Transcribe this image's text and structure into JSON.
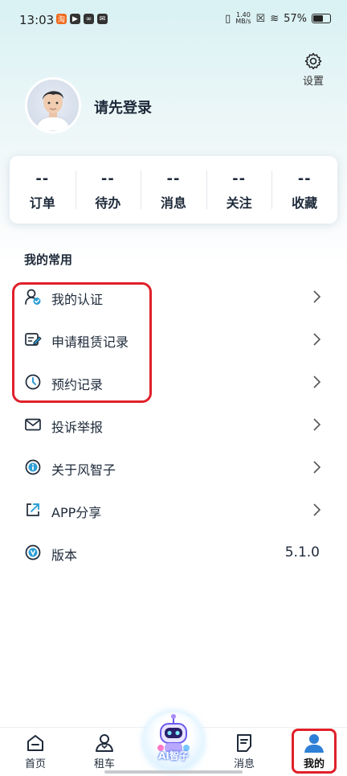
{
  "status": {
    "time": "13:03",
    "netspeed_top": "1.40",
    "netspeed_unit": "MB/s",
    "battery": "57%"
  },
  "header": {
    "settings_label": "设置",
    "login_prompt": "请先登录"
  },
  "stats": [
    {
      "value": "--",
      "label": "订单"
    },
    {
      "value": "--",
      "label": "待办"
    },
    {
      "value": "--",
      "label": "消息"
    },
    {
      "value": "--",
      "label": "关注"
    },
    {
      "value": "--",
      "label": "收藏"
    }
  ],
  "section": {
    "title": "我的常用"
  },
  "menu": [
    {
      "label": "我的认证",
      "icon": "user-verified-icon"
    },
    {
      "label": "申请租赁记录",
      "icon": "edit-document-icon"
    },
    {
      "label": "预约记录",
      "icon": "clock-icon"
    },
    {
      "label": "投诉举报",
      "icon": "mail-icon"
    },
    {
      "label": "关于风智子",
      "icon": "info-icon"
    },
    {
      "label": "APP分享",
      "icon": "share-icon"
    },
    {
      "label": "版本",
      "icon": "version-icon",
      "value": "5.1.0"
    }
  ],
  "tabbar": {
    "home": "首页",
    "rent": "租车",
    "ai": "AI智子",
    "messages": "消息",
    "mine": "我的"
  },
  "colors": {
    "accent": "#2e7fd6",
    "highlight": "#e0202a",
    "text": "#1e2a3a"
  }
}
